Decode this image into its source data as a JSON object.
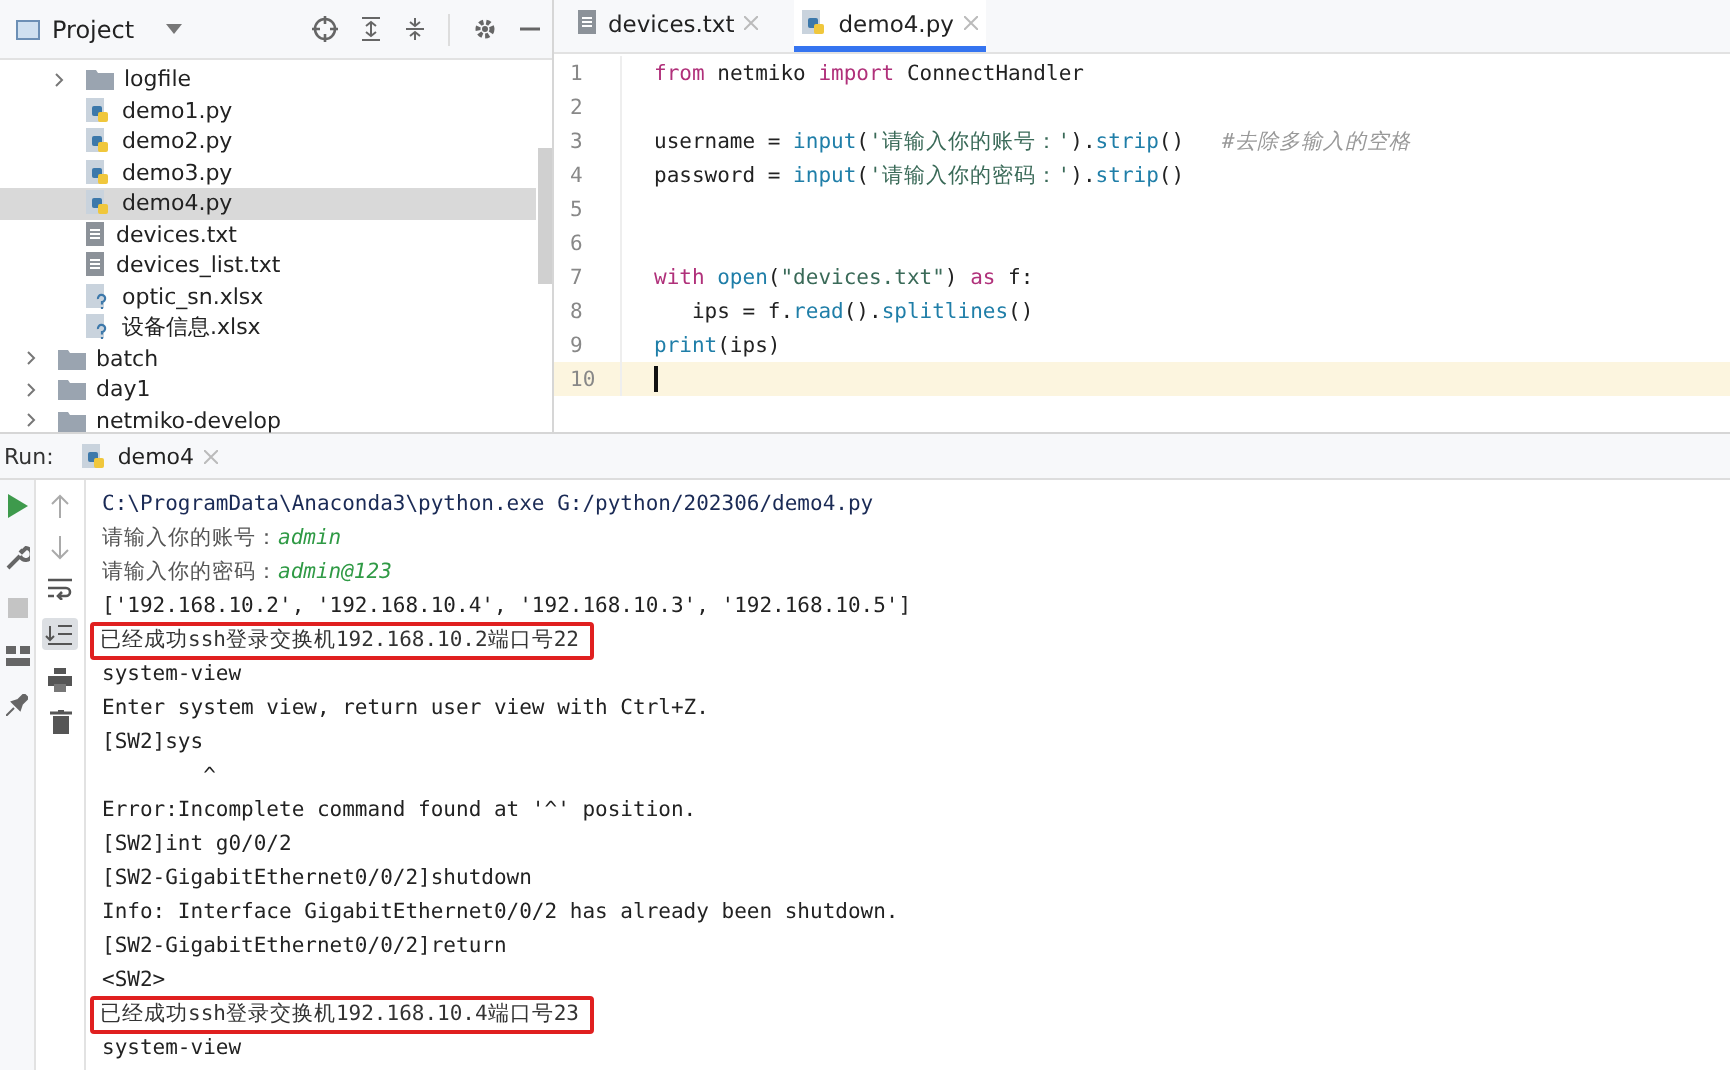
{
  "project_panel": {
    "title": "Project"
  },
  "tree": [
    {
      "children": [
        {
          "kind": "folder",
          "label": "logfile",
          "expanded": false,
          "selected": false
        },
        {
          "kind": "py",
          "label": "demo1.py",
          "selected": false
        },
        {
          "kind": "py",
          "label": "demo2.py",
          "selected": false
        },
        {
          "kind": "py",
          "label": "demo3.py",
          "selected": false
        },
        {
          "kind": "py",
          "label": "demo4.py",
          "selected": true
        },
        {
          "kind": "txt",
          "label": "devices.txt",
          "selected": false
        },
        {
          "kind": "txt",
          "label": "devices_list.txt",
          "selected": false
        },
        {
          "kind": "xlsx",
          "label": "optic_sn.xlsx",
          "selected": false
        },
        {
          "kind": "xlsx",
          "label": "设备信息.xlsx",
          "selected": false
        }
      ]
    },
    {
      "kind": "folder",
      "label": "batch",
      "expanded": false,
      "selected": false
    },
    {
      "kind": "folder",
      "label": "day1",
      "expanded": false,
      "selected": false
    },
    {
      "kind": "folder",
      "label": "netmiko-develop",
      "expanded": false,
      "selected": false
    }
  ],
  "editor_tabs": [
    {
      "kind": "txt",
      "label": "devices.txt",
      "selected": false
    },
    {
      "kind": "py",
      "label": "demo4.py",
      "selected": true
    }
  ],
  "code_lines": [
    {
      "number": "1",
      "current": false,
      "tokens": [
        {
          "kind": "kw",
          "text": "from"
        },
        {
          "kind": "plain",
          "text": " netmiko "
        },
        {
          "kind": "kw",
          "text": "import"
        },
        {
          "kind": "plain",
          "text": " ConnectHandler"
        }
      ]
    },
    {
      "number": "2",
      "current": false
    },
    {
      "number": "3",
      "current": false,
      "tokens": [
        {
          "kind": "plain",
          "text": "username = "
        },
        {
          "kind": "fn",
          "text": "input"
        },
        {
          "kind": "plain",
          "text": "("
        },
        {
          "kind": "str",
          "text": "'请输入你的账号：'"
        },
        {
          "kind": "plain",
          "text": ")."
        },
        {
          "kind": "fn",
          "text": "strip"
        },
        {
          "kind": "plain",
          "text": "()   "
        },
        {
          "kind": "comment",
          "text": "#去除多输入的空格"
        }
      ]
    },
    {
      "number": "4",
      "current": false,
      "tokens": [
        {
          "kind": "plain",
          "text": "password = "
        },
        {
          "kind": "fn",
          "text": "input"
        },
        {
          "kind": "plain",
          "text": "("
        },
        {
          "kind": "str",
          "text": "'请输入你的密码：'"
        },
        {
          "kind": "plain",
          "text": ")."
        },
        {
          "kind": "fn",
          "text": "strip"
        },
        {
          "kind": "plain",
          "text": "()"
        }
      ]
    },
    {
      "number": "5",
      "current": false
    },
    {
      "number": "6",
      "current": false
    },
    {
      "number": "7",
      "current": false,
      "tokens": [
        {
          "kind": "kw",
          "text": "with "
        },
        {
          "kind": "fn",
          "text": "open"
        },
        {
          "kind": "plain",
          "text": "("
        },
        {
          "kind": "str",
          "text": "\"devices.txt\""
        },
        {
          "kind": "plain",
          "text": ") "
        },
        {
          "kind": "kw",
          "text": "as"
        },
        {
          "kind": "plain",
          "text": " f:"
        }
      ]
    },
    {
      "number": "8",
      "current": false,
      "tokens": [
        {
          "kind": "plain",
          "text": "   ips = f."
        },
        {
          "kind": "fn",
          "text": "read"
        },
        {
          "kind": "plain",
          "text": "()."
        },
        {
          "kind": "fn",
          "text": "splitlines"
        },
        {
          "kind": "plain",
          "text": "()"
        }
      ]
    },
    {
      "number": "9",
      "current": false,
      "tokens": [
        {
          "kind": "fn",
          "text": "print"
        },
        {
          "kind": "plain",
          "text": "(ips)"
        }
      ]
    },
    {
      "number": "10",
      "current": true
    }
  ],
  "run_panel": {
    "label": "Run:",
    "tab": "demo4"
  },
  "console_lines": [
    {
      "kind": "command",
      "text": "C:\\ProgramData\\Anaconda3\\python.exe G:/python/202306/demo4.py"
    },
    {
      "kind": "prompt",
      "text": "请输入你的账号：",
      "input": "admin"
    },
    {
      "kind": "prompt",
      "text": "请输入你的密码：",
      "input": "admin@123"
    },
    {
      "kind": "output",
      "text": "['192.168.10.2', '192.168.10.4', '192.168.10.3', '192.168.10.5']"
    },
    {
      "kind": "highlighted",
      "text": "已经成功ssh登录交换机192.168.10.2端口号22"
    },
    {
      "kind": "output",
      "text": "system-view"
    },
    {
      "kind": "output",
      "text": "Enter system view, return user view with Ctrl+Z."
    },
    {
      "kind": "output",
      "text": "[SW2]sys"
    },
    {
      "kind": "output",
      "text": "        ^"
    },
    {
      "kind": "output",
      "text": "Error:Incomplete command found at '^' position."
    },
    {
      "kind": "output",
      "text": "[SW2]int g0/0/2"
    },
    {
      "kind": "output",
      "text": "[SW2-GigabitEthernet0/0/2]shutdown"
    },
    {
      "kind": "output",
      "text": "Info: Interface GigabitEthernet0/0/2 has already been shutdown."
    },
    {
      "kind": "output",
      "text": "[SW2-GigabitEthernet0/0/2]return"
    },
    {
      "kind": "output",
      "text": "<SW2>"
    },
    {
      "kind": "highlighted",
      "text": "已经成功ssh登录交换机192.168.10.4端口号23"
    },
    {
      "kind": "output",
      "text": "system-view"
    }
  ]
}
